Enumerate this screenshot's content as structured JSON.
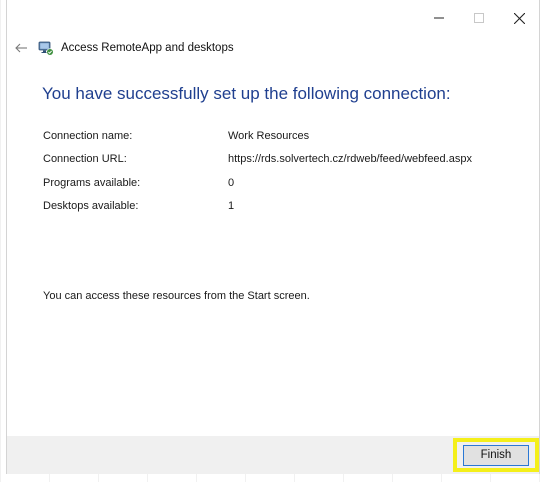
{
  "window": {
    "controls": {
      "minimize_icon": "minimize-icon",
      "maximize_icon": "maximize-icon",
      "close_icon": "close-icon"
    }
  },
  "header": {
    "back_icon": "back-arrow-icon",
    "app_icon": "remoteapp-icon",
    "title": "Access RemoteApp and desktops"
  },
  "main": {
    "heading": "You have successfully set up the following connection:",
    "details": [
      {
        "label": "Connection name:",
        "value": "Work Resources"
      },
      {
        "label": "Connection URL:",
        "value": "https://rds.solvertech.cz/rdweb/feed/webfeed.aspx"
      },
      {
        "label": "Programs available:",
        "value": "0"
      },
      {
        "label": "Desktops available:",
        "value": "1"
      }
    ],
    "note": "You can access these resources from the Start screen."
  },
  "footer": {
    "finish_label": "Finish"
  },
  "colors": {
    "heading": "#1f3f8f",
    "highlight": "#f4ef1a",
    "button_border": "#2a78d4",
    "footer_bg": "#f0f0f0"
  }
}
